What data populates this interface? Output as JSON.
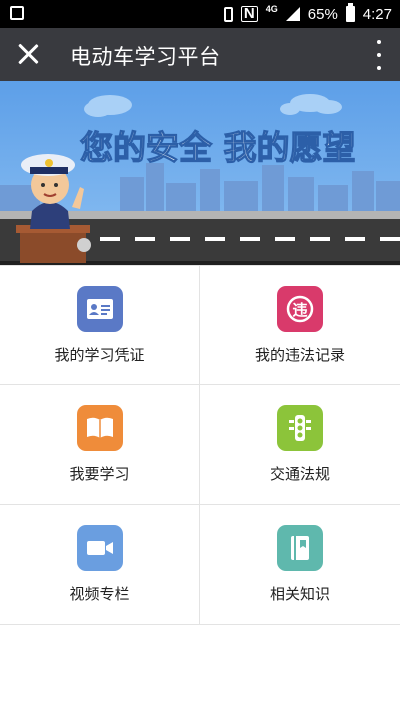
{
  "status_bar": {
    "lte_label": "4G",
    "battery": "65%",
    "time": "4:27"
  },
  "app_bar": {
    "title": "电动车学习平台"
  },
  "banner": {
    "headline": "您的安全  我的愿望"
  },
  "menu": [
    {
      "label": "我的学习凭证",
      "icon": "id-card-icon",
      "color": "#5a79c6"
    },
    {
      "label": "我的违法记录",
      "icon": "violation-icon",
      "color": "#d93a6b"
    },
    {
      "label": "我要学习",
      "icon": "book-icon",
      "color": "#ef8c3a"
    },
    {
      "label": "交通法规",
      "icon": "traffic-light-icon",
      "color": "#8cc43a"
    },
    {
      "label": "视频专栏",
      "icon": "video-camera-icon",
      "color": "#6a9ee0"
    },
    {
      "label": "相关知识",
      "icon": "notebook-icon",
      "color": "#5fb8ad"
    }
  ]
}
